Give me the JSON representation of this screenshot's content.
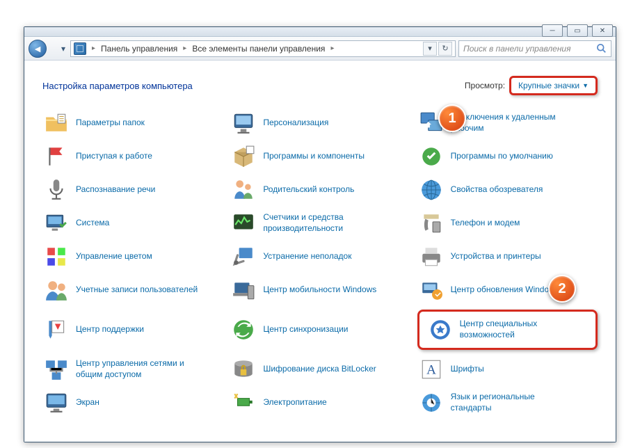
{
  "breadcrumb": {
    "root": "Панель управления",
    "current": "Все элементы панели управления"
  },
  "search": {
    "placeholder": "Поиск в панели управления"
  },
  "heading": "Настройка параметров компьютера",
  "view": {
    "label": "Просмотр:",
    "value": "Крупные значки"
  },
  "badges": {
    "one": "1",
    "two": "2"
  },
  "items": [
    {
      "label": "Параметры папок",
      "icon": "folder"
    },
    {
      "label": "Персонализация",
      "icon": "monitor"
    },
    {
      "label": "Подключения к удаленным рабочим",
      "icon": "remote"
    },
    {
      "label": "Приступая к работе",
      "icon": "flag"
    },
    {
      "label": "Программы и компоненты",
      "icon": "box"
    },
    {
      "label": "Программы по умолчанию",
      "icon": "defaults"
    },
    {
      "label": "Распознавание речи",
      "icon": "mic"
    },
    {
      "label": "Родительский контроль",
      "icon": "family"
    },
    {
      "label": "Свойства обозревателя",
      "icon": "globe"
    },
    {
      "label": "Система",
      "icon": "system"
    },
    {
      "label": "Счетчики и средства производительности",
      "icon": "perf"
    },
    {
      "label": "Телефон и модем",
      "icon": "phone"
    },
    {
      "label": "Управление цветом",
      "icon": "color"
    },
    {
      "label": "Устранение неполадок",
      "icon": "trouble"
    },
    {
      "label": "Устройства и принтеры",
      "icon": "printer"
    },
    {
      "label": "Учетные записи пользователей",
      "icon": "users"
    },
    {
      "label": "Центр мобильности Windows",
      "icon": "mobility"
    },
    {
      "label": "Центр обновления Windows",
      "icon": "update"
    },
    {
      "label": "Центр поддержки",
      "icon": "actioncenter"
    },
    {
      "label": "Центр синхронизации",
      "icon": "sync"
    },
    {
      "label": "Центр специальных возможностей",
      "icon": "ease",
      "highlight": true
    },
    {
      "label": "Центр управления сетями и общим доступом",
      "icon": "network"
    },
    {
      "label": "Шифрование диска BitLocker",
      "icon": "bitlocker"
    },
    {
      "label": "Шрифты",
      "icon": "fonts"
    },
    {
      "label": "Экран",
      "icon": "screen"
    },
    {
      "label": "Электропитание",
      "icon": "power"
    },
    {
      "label": "Язык и региональные стандарты",
      "icon": "region"
    }
  ]
}
